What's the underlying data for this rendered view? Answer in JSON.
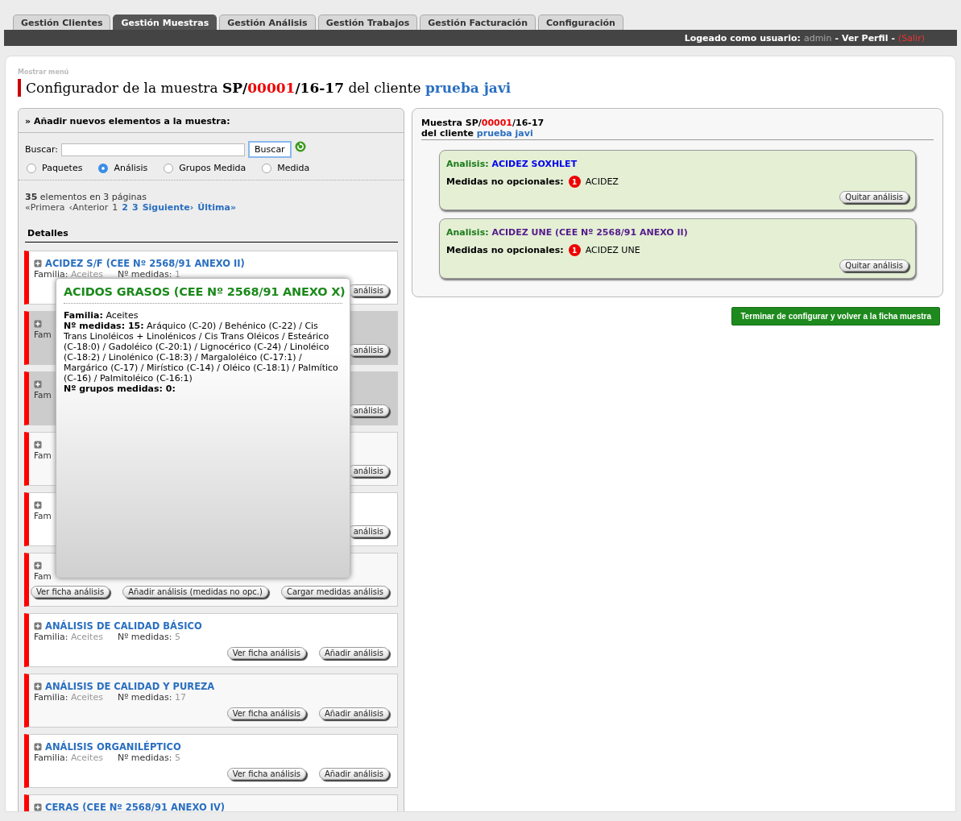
{
  "tabs": [
    {
      "label": "Gestión Clientes",
      "selected": false
    },
    {
      "label": "Gestión Muestras",
      "selected": true
    },
    {
      "label": "Gestión Análisis",
      "selected": false
    },
    {
      "label": "Gestión Trabajos",
      "selected": false
    },
    {
      "label": "Gestión Facturación",
      "selected": false
    },
    {
      "label": "Configuración",
      "selected": false
    }
  ],
  "user_bar": {
    "label": "Logeado como usuario:",
    "user": "admin",
    "separator_1": "-",
    "profile_link": "Ver Perfil",
    "separator_2": "-",
    "logout_link": "(Salir)"
  },
  "menu_toggle": "Mostrar menú",
  "page_title": {
    "prefix": "Configurador de la muestra",
    "code_series": "SP/",
    "code_number": "00001",
    "code_year": "/16-17",
    "middle": "del cliente",
    "client": "prueba javi"
  },
  "search_panel": {
    "heading": "» Añadir nuevos elementos a la muestra:",
    "search_label": "Buscar:",
    "search_button": "Buscar",
    "radios": [
      {
        "label": "Paquetes",
        "selected": false
      },
      {
        "label": "Análisis",
        "selected": true
      },
      {
        "label": "Grupos Medida",
        "selected": false
      },
      {
        "label": "Medida",
        "selected": false
      }
    ],
    "count": "35",
    "count_text": "elementos en 3 páginas",
    "pagination": [
      {
        "text": "«Primera",
        "kind": "disabled"
      },
      {
        "text": "‹Anterior",
        "kind": "disabled"
      },
      {
        "text": "1",
        "kind": "current"
      },
      {
        "text": "2",
        "kind": "link"
      },
      {
        "text": "3",
        "kind": "link"
      },
      {
        "text": "Siguiente›",
        "kind": "link"
      },
      {
        "text": "Última»",
        "kind": "link"
      }
    ],
    "details_heading": "Detalles",
    "items": [
      {
        "kind": "full",
        "highlighted": false,
        "title": "ACIDEZ S/F (CEE Nº 2568/91 ANEXO II)",
        "family_label": "Familia:",
        "family": "Aceites",
        "count_label": "Nº medidas:",
        "count": "1",
        "button_tail": "análisis"
      },
      {
        "kind": "covered",
        "highlighted": true,
        "family_fragment": "Fam",
        "button_tail": "análisis"
      },
      {
        "kind": "covered",
        "highlighted": true,
        "family_fragment": "Fam",
        "button_tail": "análisis"
      },
      {
        "kind": "covered",
        "highlighted": false,
        "family_fragment": "Fam",
        "button_tail": "análisis"
      },
      {
        "kind": "covered",
        "highlighted": false,
        "family_fragment": "Fam",
        "button_tail": "análisis"
      },
      {
        "kind": "covered_buttons",
        "highlighted": false,
        "family_fragment": "Fam",
        "buttons": [
          "Ver ficha análisis",
          "Añadir análisis (medidas no opc.)",
          "Cargar medidas análisis"
        ]
      },
      {
        "kind": "full",
        "highlighted": false,
        "title": "ANÁLISIS DE CALIDAD BÁSICO",
        "family_label": "Familia:",
        "family": "Aceites",
        "count_label": "Nº medidas:",
        "count": "5",
        "buttons": [
          "Ver ficha análisis",
          "Añadir análisis"
        ]
      },
      {
        "kind": "full",
        "highlighted": false,
        "title": "ANÁLISIS DE CALIDAD Y PUREZA",
        "family_label": "Familia:",
        "family": "Aceites",
        "count_label": "Nº medidas:",
        "count": "17",
        "buttons": [
          "Ver ficha análisis",
          "Añadir análisis"
        ]
      },
      {
        "kind": "full",
        "highlighted": false,
        "title": "ANÁLISIS ORGANILÉPTICO",
        "family_label": "Familia:",
        "family": "Aceites",
        "count_label": "Nº medidas:",
        "count": "5",
        "buttons": [
          "Ver ficha análisis",
          "Añadir análisis"
        ]
      },
      {
        "kind": "full",
        "highlighted": false,
        "title": "CERAS (CEE Nº 2568/91 ANEXO IV)"
      }
    ],
    "tooltip": {
      "title": "ACIDOS GRASOS (CEE Nº 2568/91 ANEXO X)",
      "family_label": "Familia:",
      "family": "Aceites",
      "count_label": "Nº medidas: 15:",
      "measures": "Aráquico (C-20) / Behénico (C-22) / Cis Trans Linoléicos + Linolénicos / Cis Trans Oléicos / Esteárico (C-18:0) / Gadoléico (C-20:1) / Lignocérico (C-24) / Linoléico (C-18:2) / Linolénico (C-18:3) / Margaloléico (C-17:1) / Margárico (C-17) / Mirístico (C-14) / Oléico (C-18:1) / Palmítico (C-16) / Palmitoléico (C-16:1)",
      "groups_label": "Nº grupos medidas: 0:"
    }
  },
  "sample_panel": {
    "title_prefix": "Muestra",
    "code_series": "SP/",
    "code_number": "00001",
    "code_year": "/16-17",
    "client_label": "del cliente",
    "client": "prueba javi",
    "analyses": [
      {
        "label": "Analisis:",
        "name": "ACIDEZ SOXHLET",
        "visited": false,
        "measures_label": "Medidas no opcionales:",
        "measures_count": "1",
        "measure": "ACIDEZ",
        "button": "Quitar análisis"
      },
      {
        "label": "Analisis:",
        "name": "ACIDEZ UNE (CEE Nº 2568/91 ANEXO II)",
        "visited": true,
        "measures_label": "Medidas no opcionales:",
        "measures_count": "1",
        "measure": "ACIDEZ UNE",
        "button": "Quitar análisis"
      }
    ]
  },
  "finish_button": "Terminar de configurar y volver a la ficha muestra"
}
